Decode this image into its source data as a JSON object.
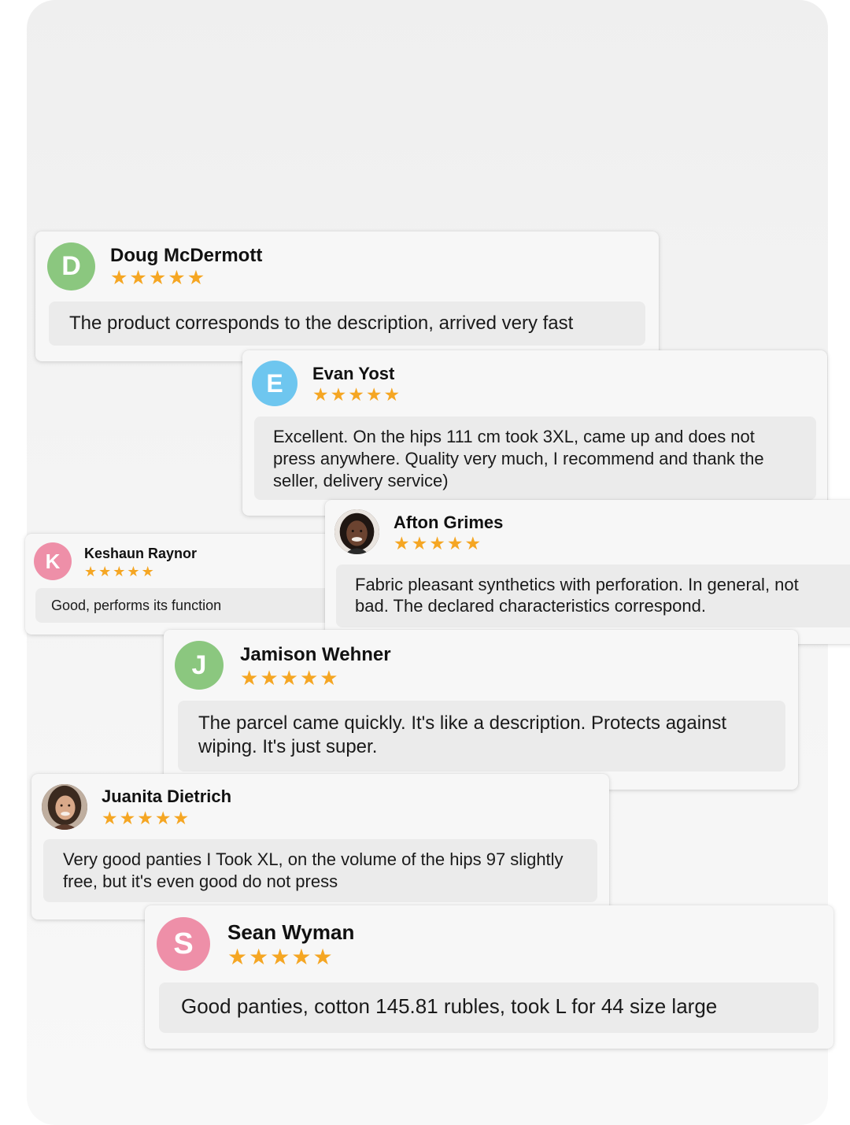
{
  "colors": {
    "star": "#f5a623",
    "avatar_green": "#8bc77f",
    "avatar_blue": "#6ec6ef",
    "avatar_pink": "#ee8fa8",
    "bubble": "#ebebeb",
    "card": "#f7f7f7"
  },
  "reviews": [
    {
      "name": "Doug McDermott",
      "initial": "D",
      "rating": 5,
      "text": "The product corresponds to the description, arrived very fast"
    },
    {
      "name": "Evan Yost",
      "initial": "E",
      "rating": 5,
      "text": "Excellent. On the hips 111 cm took 3XL, came up and does not press anywhere. Quality very much, I recommend and thank the seller, delivery service)"
    },
    {
      "name": "Keshaun Raynor",
      "initial": "K",
      "rating": 5,
      "text": "Good, performs its function"
    },
    {
      "name": "Afton Grimes",
      "initial": "",
      "rating": 5,
      "text": "Fabric pleasant synthetics with perforation. In general, not bad. The declared characteristics correspond."
    },
    {
      "name": "Jamison Wehner",
      "initial": "J",
      "rating": 5,
      "text": "The parcel came quickly. It's like a description. Protects against wiping. It's just super."
    },
    {
      "name": "Juanita Dietrich",
      "initial": "",
      "rating": 5,
      "text": "Very good panties I Took XL, on the volume of the hips 97 slightly free, but it's even good do not press"
    },
    {
      "name": "Sean Wyman",
      "initial": "S",
      "rating": 5,
      "text": "Good panties, cotton 145.81 rubles, took L for 44 size large"
    }
  ]
}
